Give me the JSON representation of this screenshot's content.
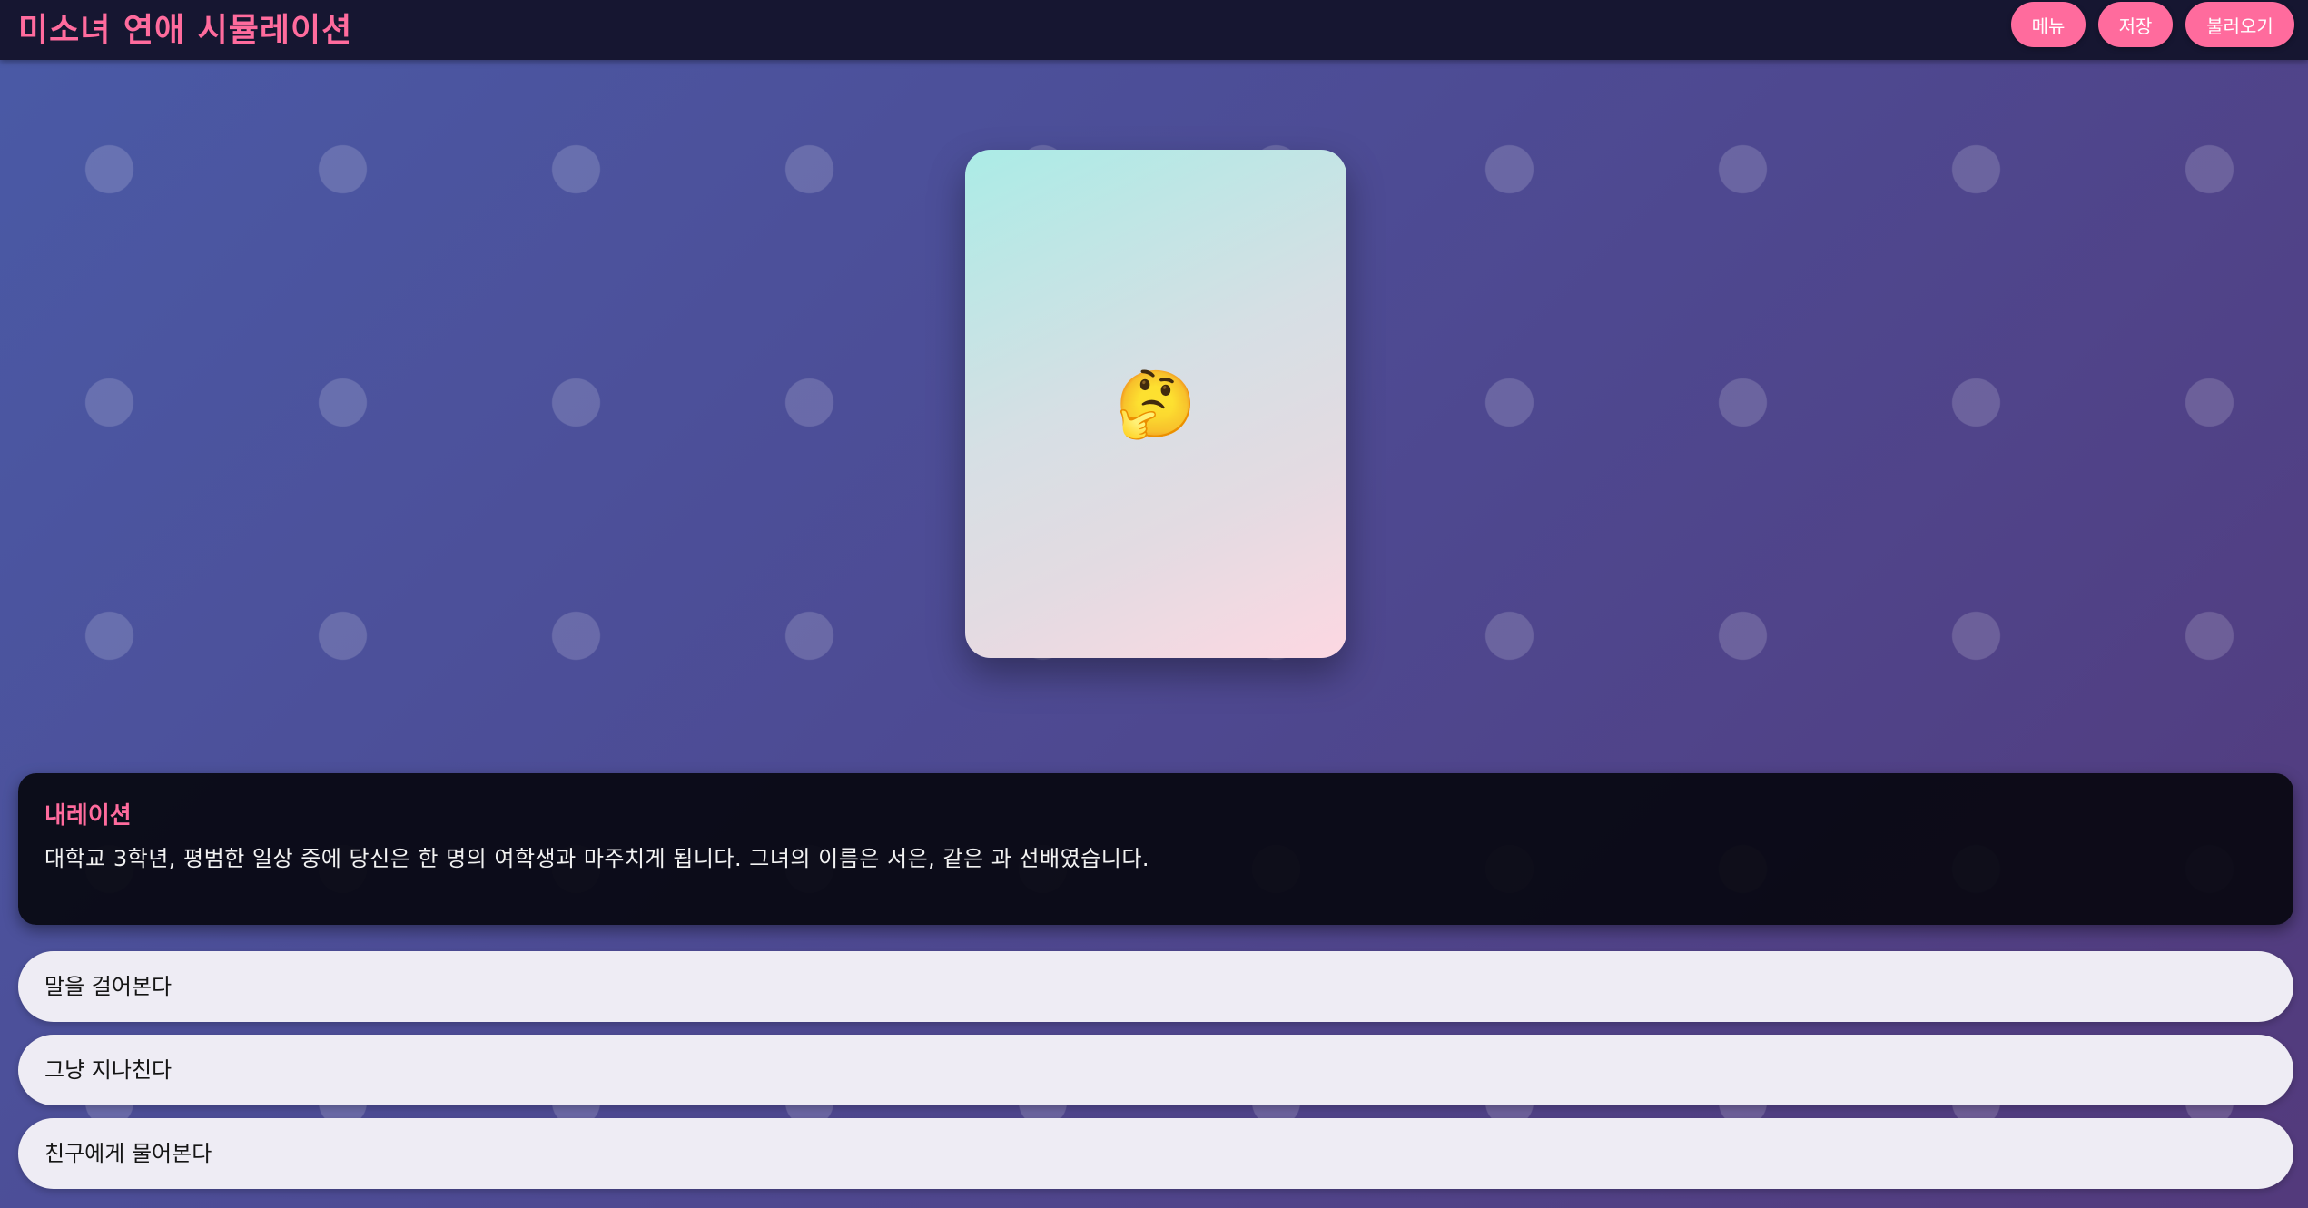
{
  "header": {
    "title": "미소녀 연애 시뮬레이션",
    "buttons": {
      "menu": "메뉴",
      "save": "저장",
      "load": "불러오기"
    }
  },
  "character": {
    "emoji": "🤔",
    "icon": "thinking-face-icon"
  },
  "narration": {
    "speaker": "내레이션",
    "text": "대학교 3학년, 평범한 일상 중에 당신은 한 명의 여학생과 마주치게 됩니다. 그녀의 이름은 서은, 같은 과 선배였습니다."
  },
  "choices": [
    {
      "label": "말을 걸어본다"
    },
    {
      "label": "그냥 지나친다"
    },
    {
      "label": "친구에게 물어본다"
    }
  ],
  "colors": {
    "accent": "#ff6b9d",
    "topbar": "#161631",
    "background_start": "#4a5aa6",
    "background_end": "#533a7c",
    "choice_background": "#eeecf4"
  }
}
